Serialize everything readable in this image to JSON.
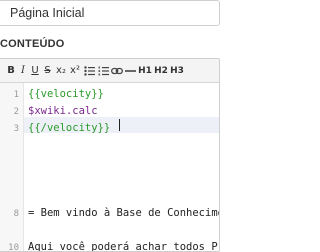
{
  "title_field": {
    "value": "Página Inicial"
  },
  "section_label": "CONTEÚDO",
  "toolbar": {
    "buttons": [
      {
        "name": "bold-button",
        "label": "B"
      },
      {
        "name": "italic-button",
        "label": "I"
      },
      {
        "name": "underline-button",
        "label": "U"
      },
      {
        "name": "strikethrough-button",
        "label": "S"
      },
      {
        "name": "subscript-button",
        "label": "x₂"
      },
      {
        "name": "superscript-button",
        "label": "x²"
      },
      {
        "name": "unordered-list-button",
        "icon": "unordered-list-icon"
      },
      {
        "name": "ordered-list-button",
        "icon": "ordered-list-icon"
      },
      {
        "name": "link-button",
        "icon": "link-icon"
      },
      {
        "name": "horizontal-rule-button",
        "icon": "horizontal-rule-icon"
      },
      {
        "name": "h1-button",
        "label": "H1"
      },
      {
        "name": "h2-button",
        "label": "H2"
      },
      {
        "name": "h3-button",
        "label": "H3"
      }
    ]
  },
  "editor": {
    "lines": [
      {
        "num": "1",
        "text": "{{velocity}}",
        "style": "vel"
      },
      {
        "num": "2",
        "text": "$xwiki.calc",
        "style": "var"
      },
      {
        "num": "3",
        "text": "{{/velocity}}",
        "style": "vel"
      },
      {
        "num": "",
        "text": "",
        "style": "txt"
      },
      {
        "num": "",
        "text": "",
        "style": "txt"
      },
      {
        "num": "",
        "text": "",
        "style": "txt"
      },
      {
        "num": "",
        "text": "",
        "style": "txt"
      },
      {
        "num": "8",
        "text": "= Bem vindo à Base de Conhecimento =",
        "style": "txt"
      },
      {
        "num": "",
        "text": "",
        "style": "txt"
      },
      {
        "num": "10",
        "text": "Aqui você poderá achar todos Procedimentos",
        "style": "txt"
      }
    ]
  }
}
